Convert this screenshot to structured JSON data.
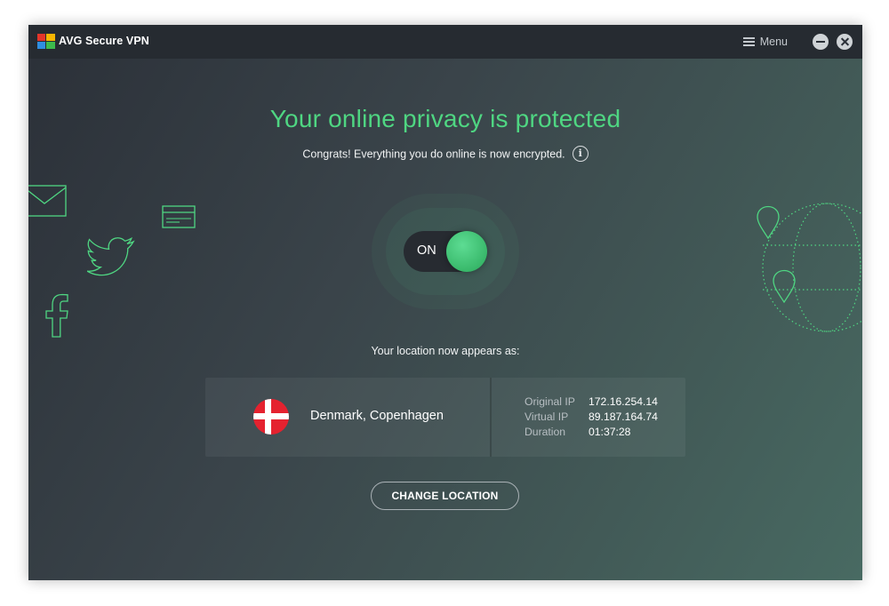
{
  "app": {
    "title": "AVG Secure VPN",
    "menu_label": "Menu"
  },
  "status": {
    "headline": "Your online privacy is protected",
    "subline": "Congrats! Everything you do online is now encrypted.",
    "info_icon": "i"
  },
  "toggle": {
    "label": "ON",
    "state": "on"
  },
  "location": {
    "caption": "Your location now appears as:",
    "name": "Denmark, Copenhagen",
    "flag": "denmark-flag",
    "details": [
      {
        "label": "Original IP",
        "value": "172.16.254.14"
      },
      {
        "label": "Virtual IP",
        "value": "89.187.164.74"
      },
      {
        "label": "Duration",
        "value": "01:37:28"
      }
    ]
  },
  "actions": {
    "change_location": "CHANGE LOCATION"
  },
  "colors": {
    "accent": "#4fd682",
    "titlebar": "#262b31",
    "danish_red": "#e5222f"
  },
  "icons": [
    "avg-logo-icon",
    "menu-icon",
    "minimize-icon",
    "close-icon",
    "info-icon",
    "mail-icon",
    "credit-card-icon",
    "twitter-icon",
    "facebook-icon",
    "map-pin-icon",
    "globe-icon"
  ]
}
